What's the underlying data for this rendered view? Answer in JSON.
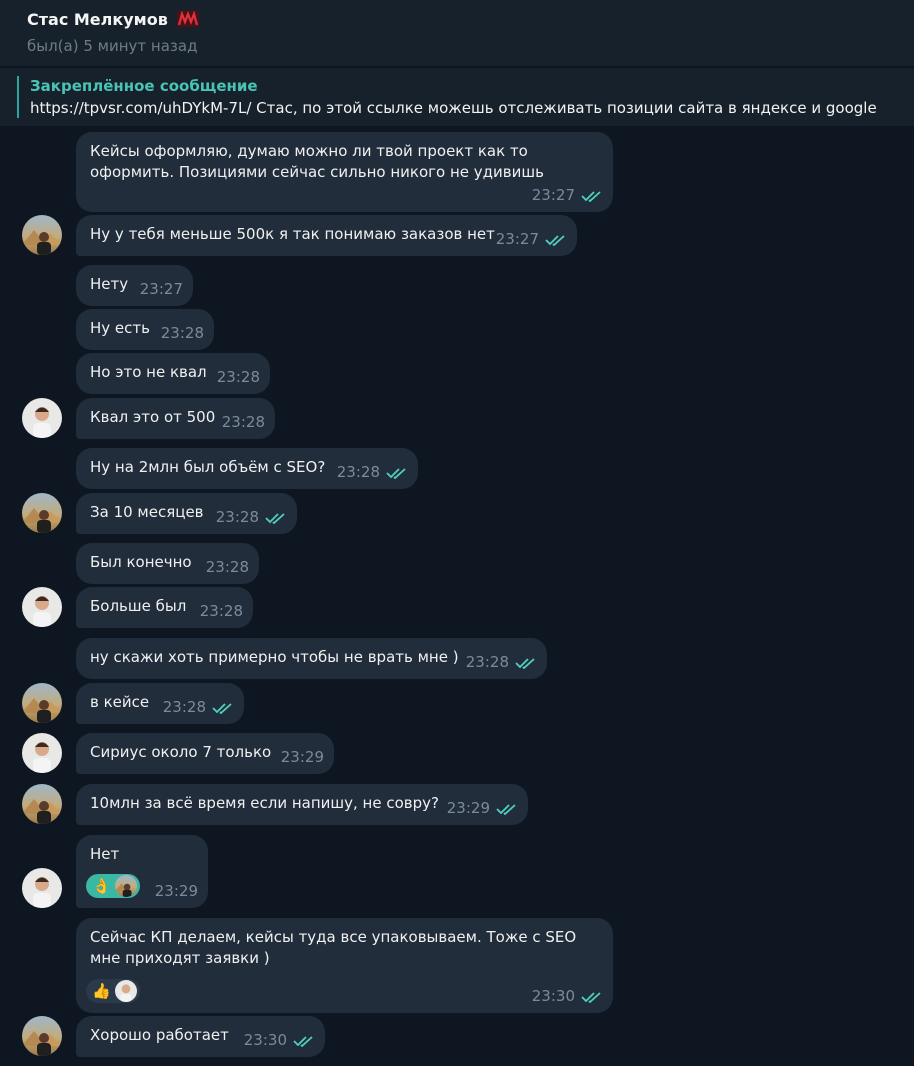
{
  "header": {
    "name": "Стас Мелкумов",
    "status": "был(а) 5 минут назад"
  },
  "pinned": {
    "title": "Закреплённое сообщение",
    "text": "https://tpvsr.com/uhDYkM-7L/  Стас, по этой ссылке можешь отслеживать позиции сайта в яндексе и google"
  },
  "messages": [
    {
      "text": "Кейсы оформляю, думаю можно ли твой проект как то оформить. Позициями сейчас сильно никого не удивишь",
      "time": "23:27",
      "read": true
    },
    {
      "text": "Ну у тебя меньше 500к я так понимаю заказов нет",
      "time": "23:27",
      "read": true
    },
    {
      "text": "Нету",
      "time": "23:27",
      "read": false
    },
    {
      "text": "Ну есть",
      "time": "23:28",
      "read": false
    },
    {
      "text": "Но это не квал",
      "time": "23:28",
      "read": false
    },
    {
      "text": "Квал это от 500",
      "time": "23:28",
      "read": false
    },
    {
      "text": "Ну на 2млн был объём с SEO?",
      "time": "23:28",
      "read": true
    },
    {
      "text": "За 10 месяцев",
      "time": "23:28",
      "read": true
    },
    {
      "text": "Был конечно",
      "time": "23:28",
      "read": false
    },
    {
      "text": "Больше был",
      "time": "23:28",
      "read": false
    },
    {
      "text": "ну скажи хоть примерно чтобы не врать мне )",
      "time": "23:28",
      "read": true
    },
    {
      "text": "в кейсе",
      "time": "23:28",
      "read": true
    },
    {
      "text": "Сириус около 7 только",
      "time": "23:29",
      "read": false
    },
    {
      "text": "10млн за всё время если напишу, не совру?",
      "time": "23:29",
      "read": true
    },
    {
      "text": "Нет",
      "time": "23:29",
      "read": false,
      "reaction": "👌"
    },
    {
      "text": "Сейчас КП делаем, кейсы туда все упаковываем. Тоже с SEO мне приходят заявки )",
      "time": "23:30",
      "read": true,
      "reaction": "👍"
    },
    {
      "text": "Хорошо работает",
      "time": "23:30",
      "read": true
    }
  ],
  "colors": {
    "background": "#0e1621",
    "bubble": "#212d3b",
    "accent": "#49c4b3",
    "read_check": "#4fd1c1"
  }
}
